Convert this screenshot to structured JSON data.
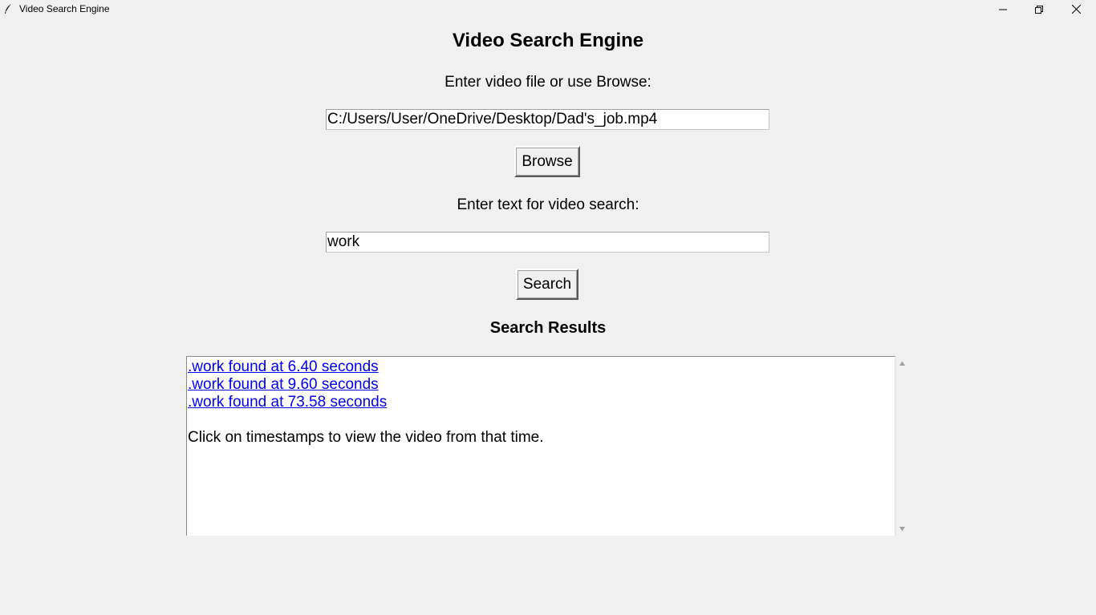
{
  "window": {
    "title": "Video Search Engine",
    "icon": "feather-icon"
  },
  "app": {
    "heading": "Video Search Engine",
    "file_label": "Enter video file or use Browse:",
    "file_value": "C:/Users/User/OneDrive/Desktop/Dad's_job.mp4",
    "browse_label": "Browse",
    "search_label": "Enter text for video search:",
    "search_value": "work",
    "search_button": "Search",
    "results_heading": "Search Results"
  },
  "results": {
    "links": [
      ".work found at 6.40 seconds",
      ".work found at 9.60 seconds",
      ".work found at 73.58 seconds"
    ],
    "note": "Click on timestamps to view the video from that time."
  },
  "colors": {
    "background": "#f0f0f0",
    "link": "#0000ee",
    "text": "#000000"
  }
}
